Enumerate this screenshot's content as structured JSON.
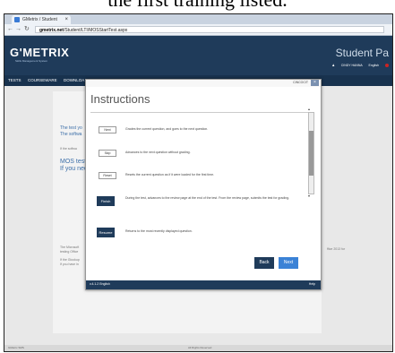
{
  "document": {
    "caption": "the first training listed."
  },
  "browser": {
    "tab_title": "GMetrix / Student",
    "url_host": "gmetrix.net",
    "url_path": "/Student/LTI/MOSStartTest.aspx"
  },
  "header": {
    "logo": "G'METRIX",
    "logo_sub": "Skills Management System",
    "portal_title": "Student Pa",
    "user_name": "CINDY HANNA",
    "language": "English"
  },
  "nav": {
    "tests": "TESTS",
    "courseware": "COURSEWARE",
    "downloads": "DOWNLOA"
  },
  "page": {
    "line1": "The test yo",
    "line2": "The softwa",
    "line3": "If the softwa",
    "mos1": "MOS test",
    "mos2": "If you nee",
    "line4": "The Microsoft",
    "line5": "testing Office",
    "line6": "If the Glookup",
    "line7": "If you have in",
    "right_note": "ffice 2013 for"
  },
  "modal": {
    "code": "CINCOCIT",
    "title": "Instructions",
    "rows": [
      {
        "button": "Next",
        "desc": "Grades the current question, and goes to the next question."
      },
      {
        "button": "Skip",
        "desc": "Advances to the next question without grading."
      },
      {
        "button": "Reset",
        "desc": "Resets the current question as if it were loaded for the first time."
      },
      {
        "button": "Finish",
        "desc": "During the test, advances to the review page at the end of the test. From the review page, submits the test for grading."
      },
      {
        "button": "Resume",
        "desc": "Returns to the most recently displayed question."
      }
    ],
    "back": "Back",
    "next": "Next",
    "version": "v.4.1.2 English",
    "help": "Help"
  },
  "footer": {
    "left": "GMetrix SMS",
    "center": "All Rights Reserved"
  }
}
